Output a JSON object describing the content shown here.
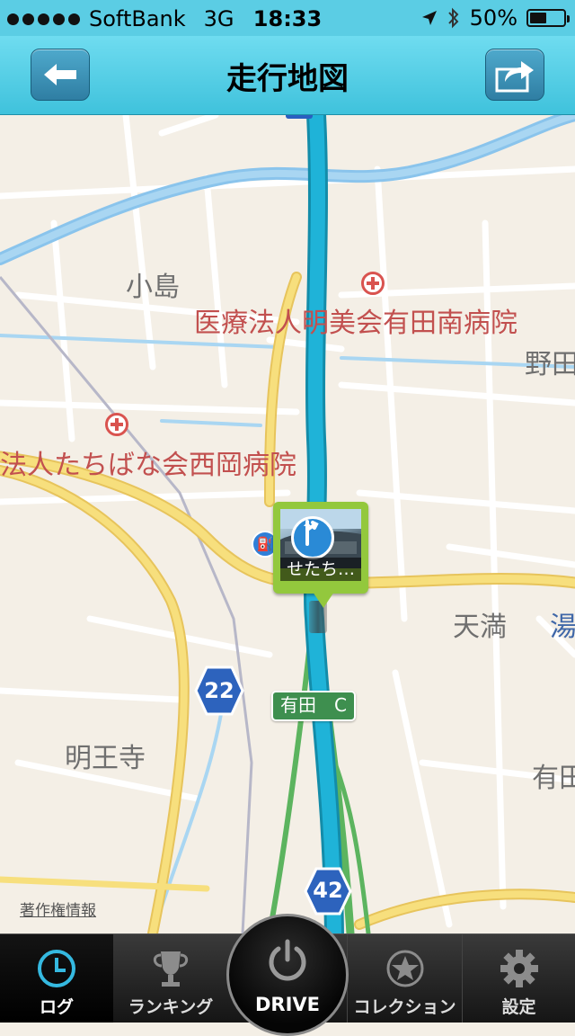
{
  "status_bar": {
    "carrier": "SoftBank",
    "network": "3G",
    "time": "18:33",
    "battery": "50%",
    "battery_level": 0.5,
    "icons": [
      "signal-dots-icon",
      "location-arrow-icon",
      "bluetooth-icon",
      "battery-icon"
    ]
  },
  "nav": {
    "title": "走行地図",
    "back_icon": "arrow-left-icon",
    "share_icon": "share-arrow-icon"
  },
  "map": {
    "places": [
      "小島",
      "野田",
      "天満",
      "湯",
      "明王寺",
      "有田"
    ],
    "hospitals": [
      "医療法人明美会有田南病院",
      "法人たちばな会西岡病院"
    ],
    "route_number": "22",
    "ic_label": "有田　C",
    "bottom_shield": "42",
    "copyright": "著作権情報",
    "pin_caption": "せたち…"
  },
  "tabs": [
    {
      "label": "ログ",
      "icon": "clock-icon",
      "active": true
    },
    {
      "label": "ランキング",
      "icon": "trophy-icon",
      "active": false
    },
    {
      "label": "DRIVE",
      "icon": "power-icon",
      "active": false
    },
    {
      "label": "コレクション",
      "icon": "star-badge-icon",
      "active": false
    },
    {
      "label": "設定",
      "icon": "gear-icon",
      "active": false
    }
  ],
  "colors": {
    "header": "#5bcde4",
    "route": "#1aa8cc",
    "pin": "#93c83d",
    "hospital_text": "#c2504f"
  }
}
